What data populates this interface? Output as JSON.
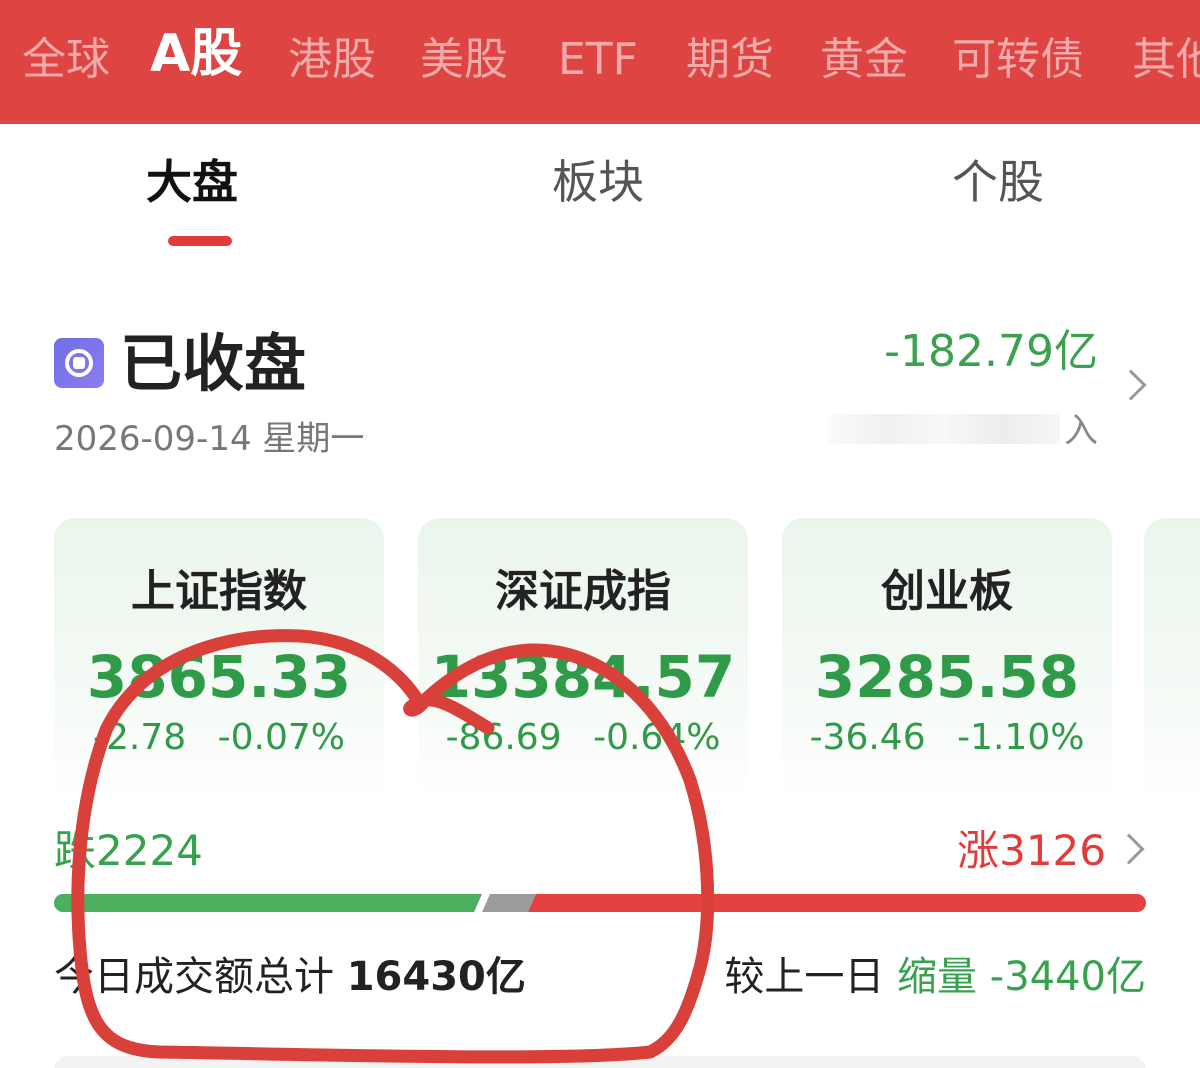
{
  "market_tabs": {
    "items": [
      "全球",
      "A股",
      "港股",
      "美股",
      "ETF",
      "期货",
      "黄金",
      "可转债",
      "其他"
    ],
    "active": "A股"
  },
  "sub_tabs": {
    "items": [
      "大盘",
      "板块",
      "个股"
    ],
    "active": "大盘"
  },
  "status": {
    "title": "已收盘",
    "date": "2026-09-14 星期一",
    "icon": "market-closed-icon"
  },
  "fund_flow": {
    "value": "-182.79亿",
    "label": "入"
  },
  "indices": [
    {
      "name": "上证指数",
      "value": "3865.33",
      "change": "-2.78",
      "change_pct": "-0.07%"
    },
    {
      "name": "深证成指",
      "value": "13384.57",
      "change": "-86.69",
      "change_pct": "-0.64%"
    },
    {
      "name": "创业板",
      "value": "3285.58",
      "change": "-36.46",
      "change_pct": "-1.10%"
    }
  ],
  "breadth": {
    "down_label": "跌2224",
    "up_label": "涨3126",
    "down": 2224,
    "up": 3126
  },
  "turnover": {
    "label": "今日成交额总计",
    "value": "16430亿",
    "compare_label": "较上一日",
    "compare_type": "缩量",
    "compare_value": "-3440亿"
  },
  "colors": {
    "brand_red": "#dd4442",
    "down_green": "#36a24d",
    "up_red": "#e03c3a",
    "annotation_red": "#d9403a"
  }
}
